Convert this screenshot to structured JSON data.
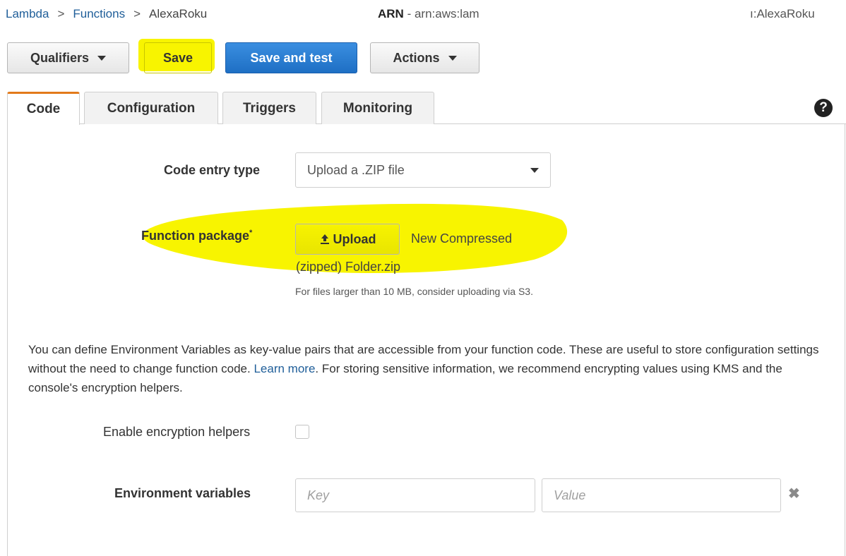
{
  "breadcrumb": {
    "lambda": "Lambda",
    "sep": ">",
    "functions": "Functions",
    "current": "AlexaRoku"
  },
  "arn": {
    "label": "ARN",
    "value": " - arn:aws:lam",
    "tail": "ı:AlexaRoku"
  },
  "toolbar": {
    "qualifiers_label": "Qualifiers",
    "save_label": "Save",
    "save_test_label": "Save and test",
    "actions_label": "Actions"
  },
  "tabs": [
    {
      "label": "Code",
      "active": true
    },
    {
      "label": "Configuration",
      "active": false
    },
    {
      "label": "Triggers",
      "active": false
    },
    {
      "label": "Monitoring",
      "active": false
    }
  ],
  "help_icon": "?",
  "code": {
    "entry_type_label": "Code entry type",
    "entry_type_value": "Upload a .ZIP file",
    "package_label": "Function package",
    "package_required": "*",
    "upload_label": "Upload",
    "upload_icon": "upload-icon",
    "file_name_line1": "New Compressed",
    "file_name_line2": "(zipped) Folder.zip",
    "hint": "For files larger than 10 MB, consider uploading via S3."
  },
  "env": {
    "description_before": "You can define Environment Variables as key-value pairs that are accessible from your function code. These are useful to store configuration settings without the need to change function code. ",
    "learn_more": "Learn more",
    "description_after": ". For storing sensitive information, we recommend encrypting values using KMS and the console's encryption helpers.",
    "encryption_label": "Enable encryption helpers",
    "encryption_checked": false,
    "variables_label": "Environment variables",
    "key_placeholder": "Key",
    "value_placeholder": "Value",
    "remove_icon": "✖"
  },
  "colors": {
    "highlight": "#f8f400",
    "primary": "#1e6fc4",
    "tab_accent": "#e27a1a",
    "link": "#1f5e99"
  }
}
